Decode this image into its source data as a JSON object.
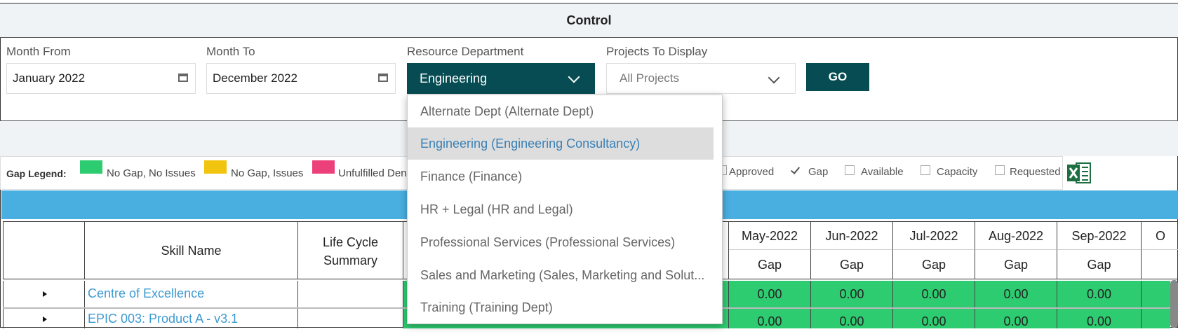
{
  "control": {
    "title": "Control"
  },
  "filters": {
    "month_from": {
      "label": "Month From",
      "value": "January 2022"
    },
    "month_to": {
      "label": "Month To",
      "value": "December 2022"
    },
    "department": {
      "label": "Resource Department",
      "value": "Engineering"
    },
    "projects": {
      "label": "Projects To Display",
      "value": "All Projects"
    },
    "go_label": "GO"
  },
  "department_options": [
    "Alternate Dept (Alternate Dept)",
    "Engineering (Engineering Consultancy)",
    "Finance (Finance)",
    "HR + Legal (HR and Legal)",
    "Professional Services (Professional Services)",
    "Sales and Marketing (Sales, Marketing and Solut...",
    "Training (Training Dept)"
  ],
  "legend": {
    "label": "Gap Legend:",
    "items": [
      {
        "label": "No Gap, No Issues",
        "color": "#2ecc71"
      },
      {
        "label": "No Gap, Issues",
        "color": "#f1c40f"
      },
      {
        "label": "Unfulfilled Den",
        "color": "#ec407a"
      }
    ],
    "checkboxes": [
      {
        "label": "Approved",
        "checked": false
      },
      {
        "label": "Gap",
        "checked": true
      },
      {
        "label": "Available",
        "checked": false
      },
      {
        "label": "Capacity",
        "checked": false
      },
      {
        "label": "Requested",
        "checked": false
      }
    ]
  },
  "table": {
    "headers": {
      "skill_name": "Skill Name",
      "life_cycle_1": "Life Cycle",
      "life_cycle_2": "Summary"
    },
    "months": [
      "May-2022",
      "Jun-2022",
      "Jul-2022",
      "Aug-2022",
      "Sep-2022",
      "O"
    ],
    "sub_header": "Gap",
    "rows": [
      {
        "name": "Centre of Excellence",
        "values": [
          "0.00",
          "0.00",
          "0.00",
          "0.00",
          "0.00"
        ]
      },
      {
        "name": "EPIC 003: Product A - v3.1",
        "values": [
          "0.00",
          "0.00",
          "0.00",
          "0.00",
          "0.00"
        ]
      }
    ]
  },
  "colors": {
    "accent": "#064c52",
    "header_blue": "#49aee0",
    "gap_green": "#2ecc71"
  }
}
